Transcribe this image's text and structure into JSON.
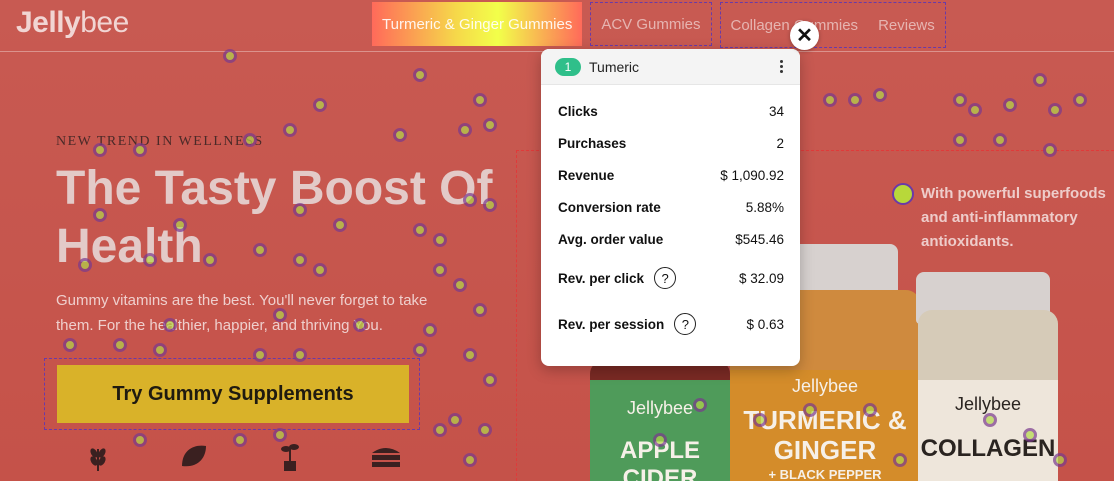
{
  "brand": {
    "logo_bold": "Jelly",
    "logo_light": "bee"
  },
  "nav": {
    "items": [
      {
        "label": "Turmeric & Ginger Gummies"
      },
      {
        "label": "ACV Gummies"
      },
      {
        "label": "Collagen Gummies"
      },
      {
        "label": "Reviews"
      }
    ]
  },
  "hero": {
    "eyebrow": "NEW TREND IN WELLNESS",
    "title": "The Tasty Boost Of Health",
    "subtitle": "Gummy vitamins are the best. You'll never forget to take them. For the healthier, happier, and thriving You.",
    "cta_label": "Try Gummy Supplements"
  },
  "features": {
    "icons": [
      "wheat-icon",
      "leaf-icon",
      "sprout-icon",
      "cake-icon"
    ]
  },
  "callout": {
    "text": "With powerful superfoods and anti-inflammatory antioxidants."
  },
  "products": {
    "jar1": {
      "brand": "Jellybee",
      "name": "APPLE CIDER"
    },
    "jar2": {
      "brand": "Jellybee",
      "name": "TURMERIC & GINGER",
      "sub": "+ BLACK PEPPER"
    },
    "jar3": {
      "brand": "Jellybee",
      "name": "COLLAGEN"
    }
  },
  "popup": {
    "badge": "1",
    "title": "Tumeric",
    "metrics": [
      {
        "label": "Clicks",
        "value": "34"
      },
      {
        "label": "Purchases",
        "value": "2"
      },
      {
        "label": "Revenue",
        "value": "$ 1,090.92"
      },
      {
        "label": "Conversion rate",
        "value": "5.88%"
      },
      {
        "label": "Avg. order value",
        "value": "$545.46"
      },
      {
        "label": "Rev. per click",
        "value": "$ 32.09"
      },
      {
        "label": "Rev. per session",
        "value": "$ 0.63"
      }
    ],
    "help_glyph": "?",
    "close_glyph": "✕"
  },
  "colors": {
    "heatmap_bg": "#c85a52",
    "cta": "#d9b229",
    "badge": "#2fbf8a",
    "dot_fill": "#b3d84a",
    "dot_ring": "#7a3a8e"
  }
}
